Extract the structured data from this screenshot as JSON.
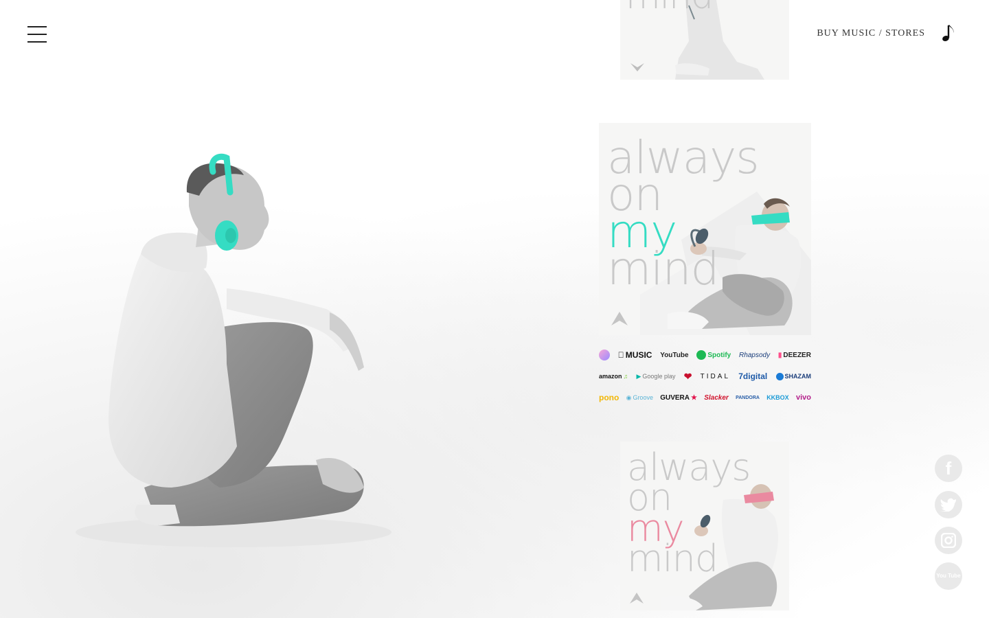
{
  "header": {
    "buy_link": "BUY MUSIC / STORES"
  },
  "album": {
    "line1": "always",
    "line2": "on",
    "line3": "my",
    "line4": "mind"
  },
  "stores": {
    "row1": [
      "MUSIC",
      "YouTube",
      "Spotify",
      "Rhapsody",
      "DEEZER"
    ],
    "row2": [
      "amazon",
      "Google play",
      "iHeart",
      "TIDAL",
      "7digital",
      "SHAZAM"
    ],
    "row3": [
      "pono",
      "Groove",
      "GUVERA",
      "Slacker",
      "PANDORA",
      "KKBOX",
      "vivo"
    ]
  },
  "colors": {
    "accent_mint": "#35dcc3",
    "accent_pink": "#ea8aa0"
  },
  "social": [
    "f",
    "t",
    "ig",
    "You Tube"
  ]
}
